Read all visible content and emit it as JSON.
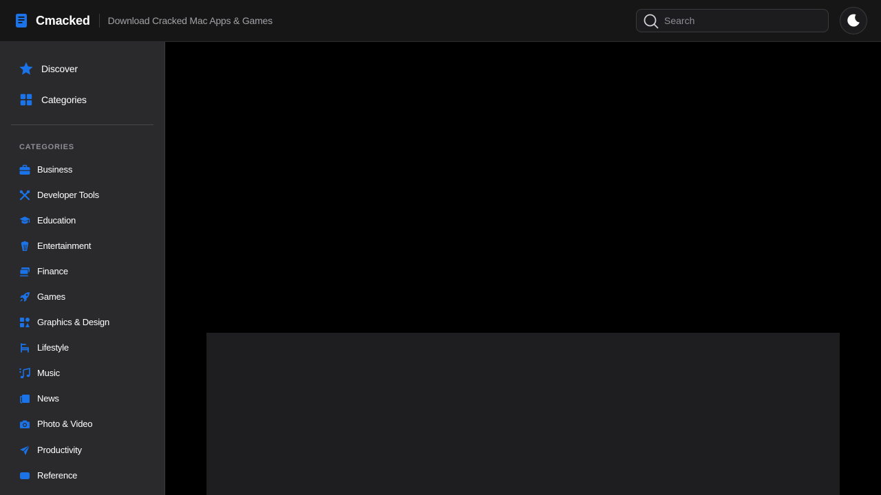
{
  "header": {
    "brand_name": "Cmacked",
    "tagline": "Download Cracked Mac Apps & Games",
    "search_placeholder": "Search",
    "theme_toggle_icon": "moon-icon"
  },
  "colors": {
    "accent": "#1a73e8",
    "topbar_bg": "#161616",
    "sidebar_bg": "#2a2a2d",
    "main_bg": "#000000",
    "card_bg": "#1e1e21"
  },
  "sidebar": {
    "nav": [
      {
        "label": "Discover",
        "icon": "star-icon"
      },
      {
        "label": "Categories",
        "icon": "grid-icon"
      }
    ],
    "heading": "CATEGORIES",
    "categories": [
      {
        "label": "Business",
        "icon": "briefcase-icon"
      },
      {
        "label": "Developer Tools",
        "icon": "tools-icon"
      },
      {
        "label": "Education",
        "icon": "graduation-cap-icon"
      },
      {
        "label": "Entertainment",
        "icon": "popcorn-icon"
      },
      {
        "label": "Finance",
        "icon": "money-icon"
      },
      {
        "label": "Games",
        "icon": "rocket-icon"
      },
      {
        "label": "Graphics & Design",
        "icon": "shapes-icon"
      },
      {
        "label": "Lifestyle",
        "icon": "chair-icon"
      },
      {
        "label": "Music",
        "icon": "music-icon"
      },
      {
        "label": "News",
        "icon": "newspaper-icon"
      },
      {
        "label": "Photo & Video",
        "icon": "camera-icon"
      },
      {
        "label": "Productivity",
        "icon": "paper-plane-icon"
      },
      {
        "label": "Reference",
        "icon": "book-icon"
      }
    ]
  }
}
